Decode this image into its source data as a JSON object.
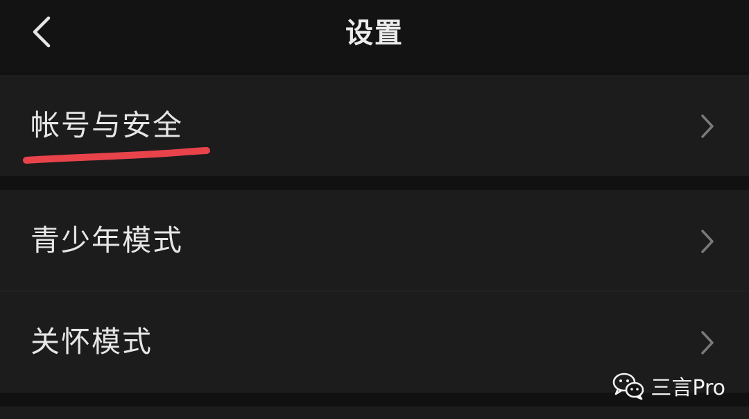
{
  "header": {
    "title": "设置",
    "back_icon": "chevron-left-icon"
  },
  "settings": {
    "items": [
      {
        "label": "帐号与安全",
        "icon": "chevron-right-icon"
      },
      {
        "label": "青少年模式",
        "icon": "chevron-right-icon"
      },
      {
        "label": "关怀模式",
        "icon": "chevron-right-icon"
      }
    ]
  },
  "annotation": {
    "underline_color": "#e8434b"
  },
  "watermark": {
    "text": "三言Pro",
    "icon": "wechat-icon"
  },
  "colors": {
    "background": "#111111",
    "row_background": "#1c1c1c",
    "text": "#e6e6e6",
    "chevron": "#7a7a7a"
  }
}
